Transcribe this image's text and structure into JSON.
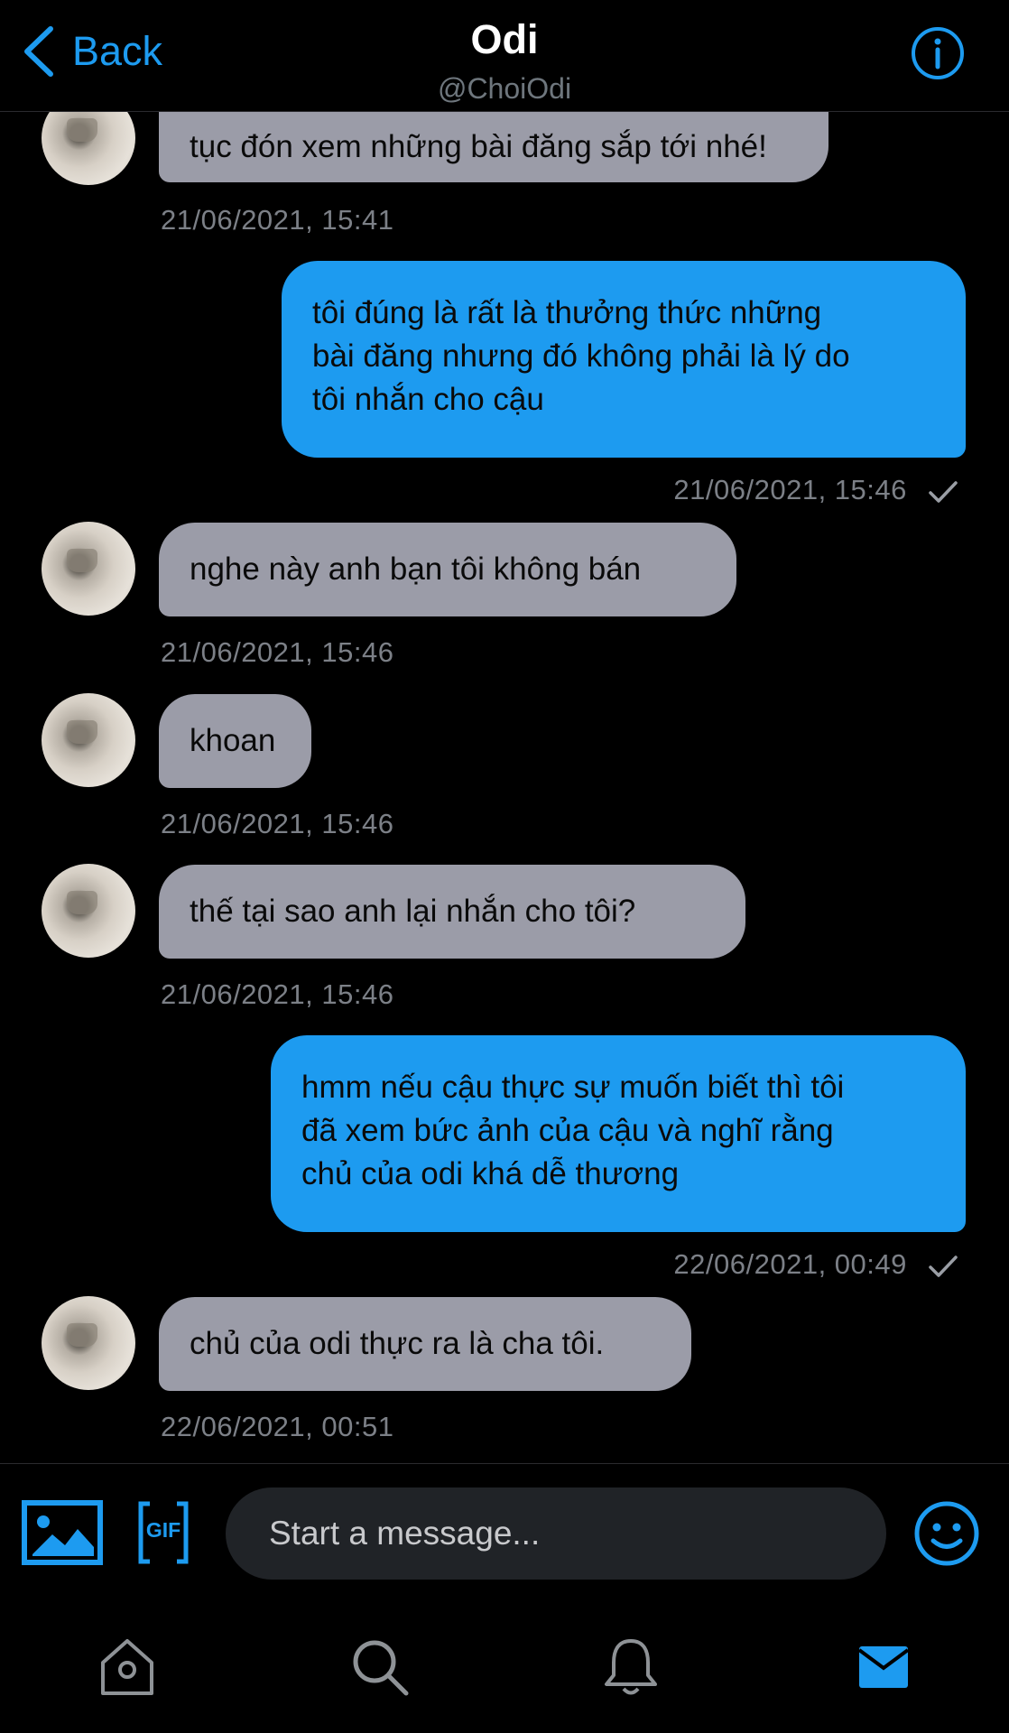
{
  "header": {
    "back_label": "Back",
    "title": "Odi",
    "handle": "@ChoiOdi"
  },
  "messages": [
    {
      "direction": "incoming",
      "lines": [
        "tục đón xem những bài đăng sắp tới nhé!"
      ],
      "timestamp": "21/06/2021, 15:41"
    },
    {
      "direction": "outgoing",
      "lines": [
        "tôi đúng là rất là thưởng thức những",
        "bài đăng nhưng đó không phải là lý do",
        "tôi nhắn cho cậu"
      ],
      "timestamp": "21/06/2021, 15:46",
      "read": true
    },
    {
      "direction": "incoming",
      "lines": [
        "nghe này anh bạn tôi không bán"
      ],
      "timestamp": "21/06/2021, 15:46"
    },
    {
      "direction": "incoming",
      "lines": [
        "khoan"
      ],
      "timestamp": "21/06/2021, 15:46"
    },
    {
      "direction": "incoming",
      "lines": [
        "thế tại sao anh lại nhắn cho tôi?"
      ],
      "timestamp": "21/06/2021, 15:46"
    },
    {
      "direction": "outgoing",
      "lines": [
        "hmm nếu cậu thực sự muốn biết thì tôi",
        "đã xem bức ảnh của cậu và nghĩ rằng",
        "chủ của odi khá dễ thương"
      ],
      "timestamp": "22/06/2021, 00:49",
      "read": true
    },
    {
      "direction": "incoming",
      "lines": [
        "chủ của odi thực ra là cha tôi."
      ],
      "timestamp": "22/06/2021, 00:51"
    }
  ],
  "composer": {
    "placeholder": "Start a message...",
    "gif_label": "GIF",
    "icons": [
      "image-icon",
      "gif-icon",
      "emoji-icon"
    ]
  },
  "tabbar": {
    "items": [
      "home-icon",
      "search-icon",
      "notifications-icon",
      "messages-icon"
    ],
    "active": "messages-icon"
  },
  "colors": {
    "accent": "#1d9bf0",
    "incoming_bubble": "#9b9ca8",
    "timestamp": "#7c8087",
    "background": "#000000"
  }
}
